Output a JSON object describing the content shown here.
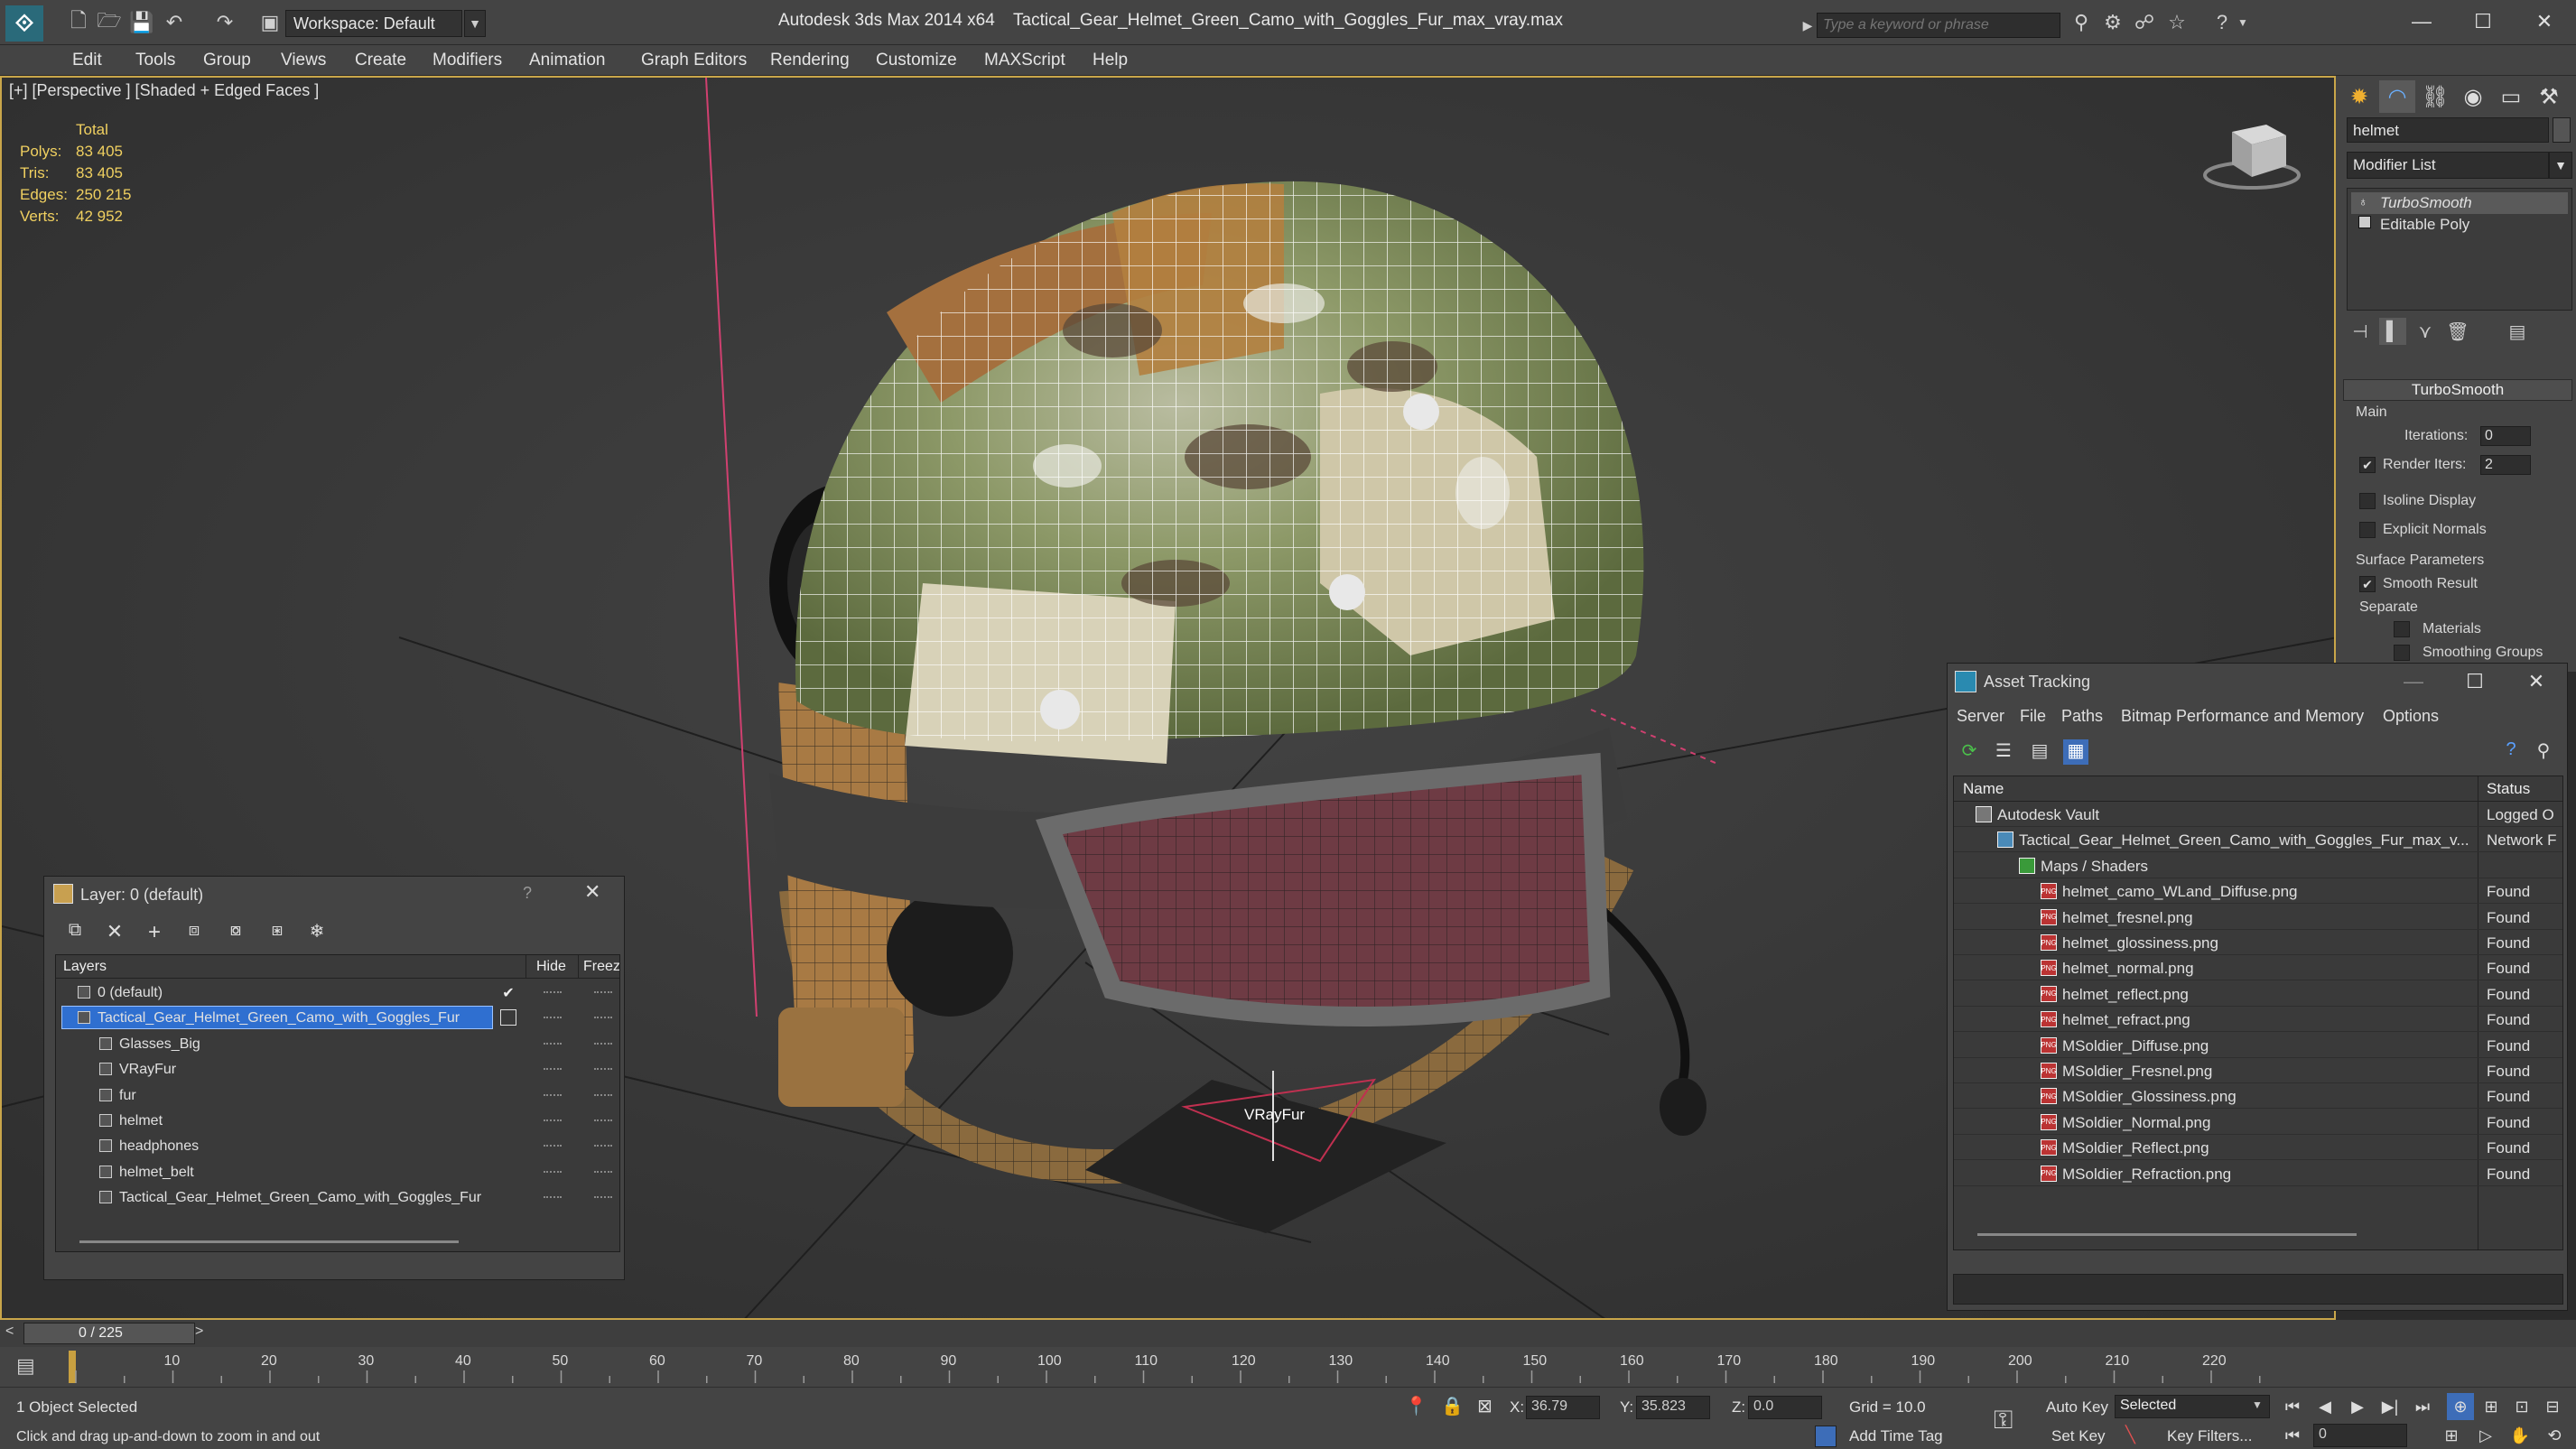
{
  "titlebar": {
    "workspace": "Workspace: Default",
    "app_title": "Autodesk 3ds Max  2014 x64",
    "file_title": "Tactical_Gear_Helmet_Green_Camo_with_Goggles_Fur_max_vray.max",
    "search_placeholder": "Type a keyword or phrase"
  },
  "menu": [
    "Edit",
    "Tools",
    "Group",
    "Views",
    "Create",
    "Modifiers",
    "Animation",
    "Graph Editors",
    "Rendering",
    "Customize",
    "MAXScript",
    "Help"
  ],
  "viewport": {
    "label": "[+] [Perspective ] [Shaded + Edged Faces ]",
    "stats_header": "Total",
    "stats": [
      {
        "label": "Polys:",
        "value": "83 405"
      },
      {
        "label": "Tris:",
        "value": "83 405"
      },
      {
        "label": "Edges:",
        "value": "250 215"
      },
      {
        "label": "Verts:",
        "value": "42 952"
      }
    ],
    "gizmo_label": "VRayFur"
  },
  "command_panel": {
    "object_name": "helmet",
    "modifier_list": "Modifier List",
    "stack": [
      "TurboSmooth",
      "Editable Poly"
    ],
    "rollout_title": "TurboSmooth",
    "main_label": "Main",
    "iterations_label": "Iterations:",
    "iterations_value": "0",
    "render_iters_label": "Render Iters:",
    "render_iters_value": "2",
    "isoline_label": "Isoline Display",
    "explicit_normals_label": "Explicit Normals",
    "surface_params_label": "Surface Parameters",
    "smooth_result_label": "Smooth Result",
    "separate_label": "Separate",
    "materials_label": "Materials",
    "smoothing_groups_label": "Smoothing Groups"
  },
  "asset_tracking": {
    "title": "Asset Tracking",
    "menu": [
      "Server",
      "File",
      "Paths",
      "Bitmap Performance and Memory",
      "Options"
    ],
    "col_name": "Name",
    "col_status": "Status",
    "rows": [
      {
        "name": "Autodesk Vault",
        "status": "Logged O",
        "level": 0,
        "icon": "vault"
      },
      {
        "name": "Tactical_Gear_Helmet_Green_Camo_with_Goggles_Fur_max_v...",
        "status": "Network F",
        "level": 1,
        "icon": "max"
      },
      {
        "name": "Maps / Shaders",
        "status": "",
        "level": 2,
        "icon": "maps"
      },
      {
        "name": "helmet_camo_WLand_Diffuse.png",
        "status": "Found",
        "level": 3,
        "icon": "png"
      },
      {
        "name": "helmet_fresnel.png",
        "status": "Found",
        "level": 3,
        "icon": "png"
      },
      {
        "name": "helmet_glossiness.png",
        "status": "Found",
        "level": 3,
        "icon": "png"
      },
      {
        "name": "helmet_normal.png",
        "status": "Found",
        "level": 3,
        "icon": "png"
      },
      {
        "name": "helmet_reflect.png",
        "status": "Found",
        "level": 3,
        "icon": "png"
      },
      {
        "name": "helmet_refract.png",
        "status": "Found",
        "level": 3,
        "icon": "png"
      },
      {
        "name": "MSoldier_Diffuse.png",
        "status": "Found",
        "level": 3,
        "icon": "png"
      },
      {
        "name": "MSoldier_Fresnel.png",
        "status": "Found",
        "level": 3,
        "icon": "png"
      },
      {
        "name": "MSoldier_Glossiness.png",
        "status": "Found",
        "level": 3,
        "icon": "png"
      },
      {
        "name": "MSoldier_Normal.png",
        "status": "Found",
        "level": 3,
        "icon": "png"
      },
      {
        "name": "MSoldier_Reflect.png",
        "status": "Found",
        "level": 3,
        "icon": "png"
      },
      {
        "name": "MSoldier_Refraction.png",
        "status": "Found",
        "level": 3,
        "icon": "png"
      }
    ]
  },
  "layer_window": {
    "title": "Layer: 0 (default)",
    "help": "?",
    "col_layers": "Layers",
    "col_hide": "Hide",
    "col_freeze": "Freez",
    "rows": [
      {
        "name": "0 (default)",
        "level": 0,
        "selected": false,
        "checked": true
      },
      {
        "name": "Tactical_Gear_Helmet_Green_Camo_with_Goggles_Fur",
        "level": 0,
        "selected": true,
        "checked": false
      },
      {
        "name": "Glasses_Big",
        "level": 1,
        "selected": false,
        "checked": false
      },
      {
        "name": "VRayFur",
        "level": 1,
        "selected": false,
        "checked": false
      },
      {
        "name": "fur",
        "level": 1,
        "selected": false,
        "checked": false
      },
      {
        "name": "helmet",
        "level": 1,
        "selected": false,
        "checked": false
      },
      {
        "name": "headphones",
        "level": 1,
        "selected": false,
        "checked": false
      },
      {
        "name": "helmet_belt",
        "level": 1,
        "selected": false,
        "checked": false
      },
      {
        "name": "Tactical_Gear_Helmet_Green_Camo_with_Goggles_Fur",
        "level": 1,
        "selected": false,
        "checked": false
      }
    ]
  },
  "timeline": {
    "frame_display": "0 / 225",
    "ticks": [
      "10",
      "20",
      "30",
      "40",
      "50",
      "60",
      "70",
      "80",
      "90",
      "100",
      "110",
      "120",
      "130",
      "140",
      "150",
      "160",
      "170",
      "180",
      "190",
      "200",
      "210",
      "220"
    ]
  },
  "status": {
    "selection": "1 Object Selected",
    "prompt": "Click and drag up-and-down to zoom in and out",
    "x_label": "X:",
    "x_value": "36.79",
    "y_label": "Y:",
    "y_value": "35.823",
    "z_label": "Z:",
    "z_value": "0.0",
    "grid": "Grid = 10.0",
    "add_time_tag": "Add Time Tag",
    "auto_key": "Auto Key",
    "set_key": "Set Key",
    "selected_dropdown": "Selected",
    "key_filters": "Key Filters...",
    "frame_field": "0"
  },
  "colors": {
    "viewport_border": "#c9a64a",
    "stats_text": "#f0d060",
    "selection_blue": "#2f6fd0",
    "found_status": "#e0e0e0"
  }
}
